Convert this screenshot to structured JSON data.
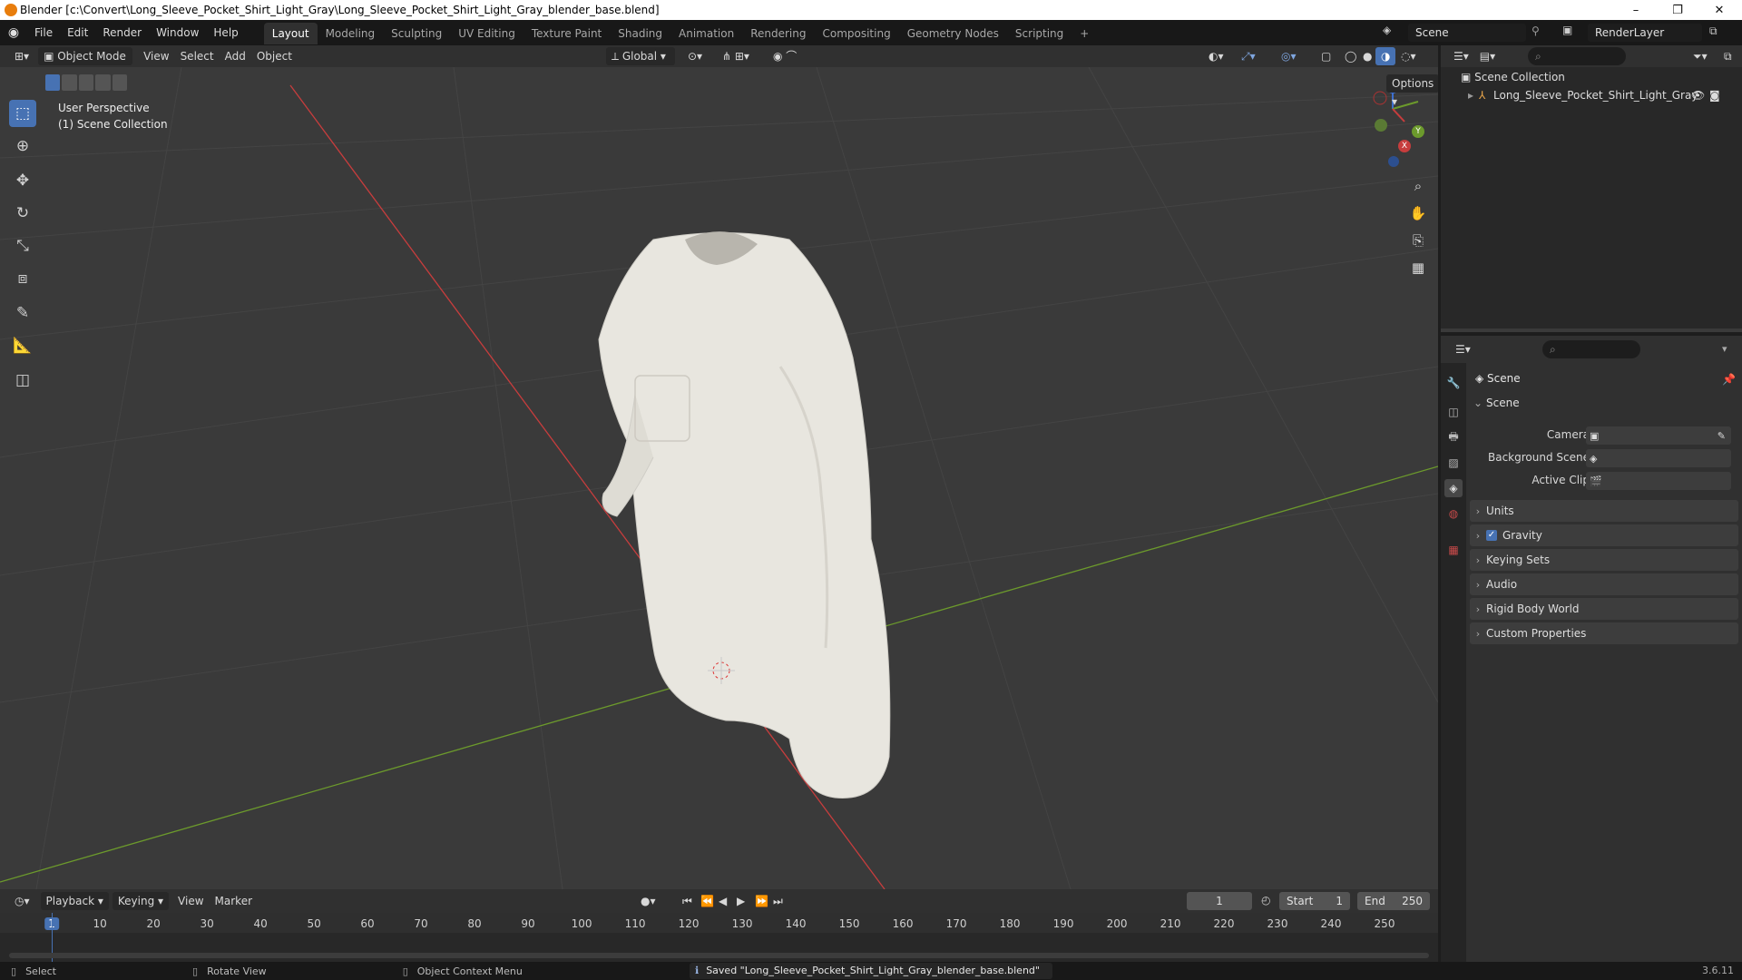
{
  "window": {
    "title": "Blender [c:\\Convert\\Long_Sleeve_Pocket_Shirt_Light_Gray\\Long_Sleeve_Pocket_Shirt_Light_Gray_blender_base.blend]",
    "minimize": "–",
    "maximize": "❐",
    "close": "✕"
  },
  "menu": [
    "File",
    "Edit",
    "Render",
    "Window",
    "Help"
  ],
  "workspaces": [
    "Layout",
    "Modeling",
    "Sculpting",
    "UV Editing",
    "Texture Paint",
    "Shading",
    "Animation",
    "Rendering",
    "Compositing",
    "Geometry Nodes",
    "Scripting"
  ],
  "workspace_add": "+",
  "scene_field": "Scene",
  "render_layer_field": "RenderLayer",
  "viewport": {
    "mode": "Object Mode",
    "header_menus": [
      "View",
      "Select",
      "Add",
      "Object"
    ],
    "orientation": "Global",
    "options": "Options",
    "overlay_line1": "User Perspective",
    "overlay_line2": "(1) Scene Collection",
    "gizmo": {
      "x": "X",
      "y": "Y",
      "z": "Z"
    }
  },
  "outliner": {
    "root": "Scene Collection",
    "items": [
      {
        "label": "Long_Sleeve_Pocket_Shirt_Light_Gray"
      }
    ]
  },
  "properties": {
    "header": "Scene",
    "scene_panel": "Scene",
    "camera_label": "Camera",
    "background_label": "Background Scene",
    "clip_label": "Active Clip",
    "panels": [
      "Units",
      "Gravity",
      "Keying Sets",
      "Audio",
      "Rigid Body World",
      "Custom Properties"
    ]
  },
  "timeline": {
    "menus": [
      "Playback",
      "Keying",
      "View",
      "Marker"
    ],
    "current_frame": "1",
    "start_label": "Start",
    "start": "1",
    "end_label": "End",
    "end": "250",
    "ticks": [
      "1",
      "10",
      "20",
      "30",
      "40",
      "50",
      "60",
      "70",
      "80",
      "90",
      "100",
      "110",
      "120",
      "130",
      "140",
      "150",
      "160",
      "170",
      "180",
      "190",
      "200",
      "210",
      "220",
      "230",
      "240",
      "250"
    ]
  },
  "status": {
    "select": "Select",
    "rotate": "Rotate View",
    "context": "Object Context Menu",
    "message": "Saved \"Long_Sleeve_Pocket_Shirt_Light_Gray_blender_base.blend\"",
    "version": "3.6.11"
  },
  "colors": {
    "accent": "#4772b3",
    "x_axis": "#c73d3d",
    "y_axis": "#6c9a2c",
    "z_axis": "#3d6fcf",
    "shirt": "#e8e6df"
  }
}
